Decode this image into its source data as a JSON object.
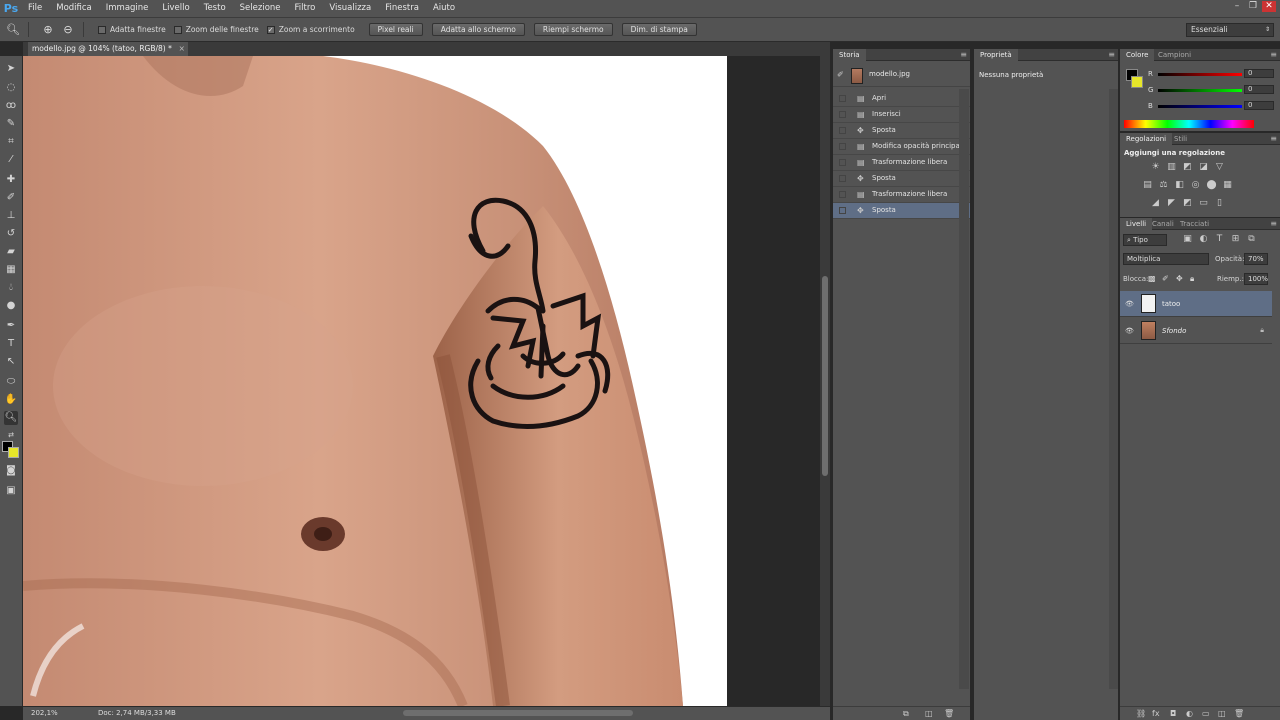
{
  "app": {
    "logo": "Ps"
  },
  "menu": [
    "File",
    "Modifica",
    "Immagine",
    "Livello",
    "Testo",
    "Selezione",
    "Filtro",
    "Visualizza",
    "Finestra",
    "Aiuto"
  ],
  "options": {
    "checkboxes": [
      {
        "label": "Adatta finestre",
        "checked": false
      },
      {
        "label": "Zoom delle finestre",
        "checked": false
      },
      {
        "label": "Zoom a scorrimento",
        "checked": true
      }
    ],
    "buttons": [
      "Pixel reali",
      "Adatta allo schermo",
      "Riempi schermo",
      "Dim. di stampa"
    ],
    "workspace": "Essenziali"
  },
  "document": {
    "tab": "modello.jpg @ 104% (tatoo, RGB/8) *"
  },
  "status": {
    "zoom": "202,1%",
    "doc": "Doc: 2,74 MB/3,33 MB"
  },
  "history": {
    "tab": "Storia",
    "snapshot": "modello.jpg",
    "items": [
      "Apri",
      "Inserisci",
      "Sposta",
      "Modifica opacità principale",
      "Trasformazione libera",
      "Sposta",
      "Trasformazione libera",
      "Sposta"
    ],
    "selected_index": 7
  },
  "properties": {
    "tab": "Proprietà",
    "empty": "Nessuna proprietà"
  },
  "color": {
    "tabs": [
      "Colore",
      "Campioni"
    ],
    "channels": [
      {
        "label": "R",
        "value": "0"
      },
      {
        "label": "G",
        "value": "0"
      },
      {
        "label": "B",
        "value": "0"
      }
    ],
    "fg": "#000000",
    "bg": "#e6e62a"
  },
  "adjustments": {
    "tabs": [
      "Regolazioni",
      "Stili"
    ],
    "title": "Aggiungi una regolazione"
  },
  "layers": {
    "tabs": [
      "Livelli",
      "Canali",
      "Tracciati"
    ],
    "filter": "Tipo",
    "blend": "Moltiplica",
    "opacity_label": "Opacità:",
    "opacity": "70%",
    "lock_label": "Blocca:",
    "fill_label": "Riemp.:",
    "fill": "100%",
    "items": [
      {
        "name": "tatoo",
        "selected": true
      },
      {
        "name": "Sfondo",
        "selected": false,
        "locked": true
      }
    ]
  }
}
